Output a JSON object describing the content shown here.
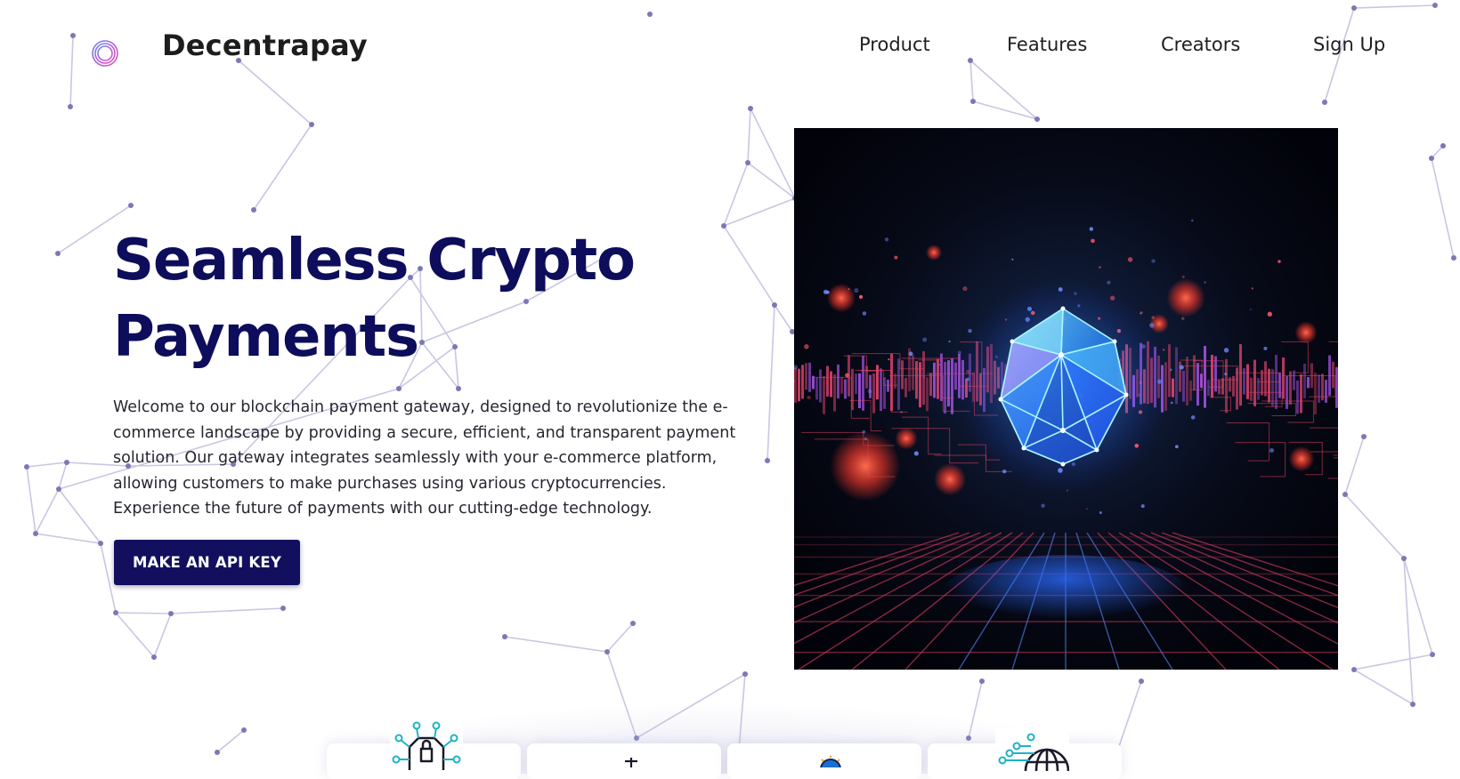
{
  "header": {
    "brand_name": "Decentrapay",
    "logo_icon": "decentrapay-logo-icon",
    "nav": [
      {
        "label": "Product"
      },
      {
        "label": "Features"
      },
      {
        "label": "Creators"
      },
      {
        "label": "Sign Up"
      }
    ]
  },
  "hero": {
    "title_line1": "Seamless Crypto",
    "title_line2": "Payments",
    "description": "Welcome to our blockchain payment gateway, designed to revolutionize the e-commerce landscape by providing a secure, efficient, and transparent payment solution. Our gateway integrates seamlessly with your e-commerce platform, allowing customers to make purchases using various cryptocurrencies. Experience the future of payments with our cutting-edge technology.",
    "cta_label": "MAKE AN API KEY",
    "image_subject": "crypto-crystal-illustration"
  },
  "feature_cards": [
    {
      "icon": "security-lock-network-icon"
    },
    {
      "icon": "chart-arrow-icon"
    },
    {
      "icon": "coin-badge-icon"
    },
    {
      "icon": "globe-network-icon"
    }
  ],
  "colors": {
    "title": "#0d0d5c",
    "button_bg": "#12105e",
    "button_text": "#ffffff",
    "network_lines": "#c9c6e2",
    "network_nodes": "#7c78b4"
  }
}
